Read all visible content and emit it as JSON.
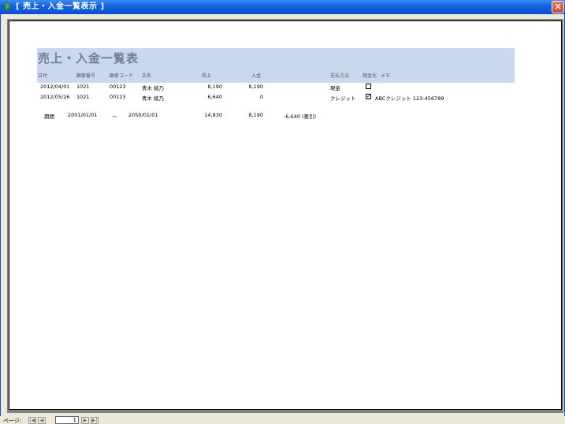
{
  "window": {
    "title": "[ 売上・入金一覧表示 ]"
  },
  "report": {
    "title": "売上・入金一覧表",
    "headers": {
      "date": "日付",
      "customer_no": "顧客番号",
      "customer_code": "顧客コード",
      "name": "氏名",
      "sales": "売上",
      "payment": "入金",
      "pay_method": "支払方法",
      "cashed": "現金化",
      "memo": "メモ"
    },
    "rows": [
      {
        "date": "2012/04/01",
        "customer_no": "1021",
        "customer_code": "00123",
        "name": "青木 綾乃",
        "sales": "8,190",
        "payment": "8,190",
        "pay_method": "現金",
        "cashed": false,
        "memo": ""
      },
      {
        "date": "2012/05/26",
        "customer_no": "1021",
        "customer_code": "00123",
        "name": "青木 綾乃",
        "sales": "6,640",
        "payment": "0",
        "pay_method": "クレジット",
        "cashed": true,
        "memo": "ABCクレジット 123-456789"
      }
    ],
    "summary": {
      "period_label": "期間",
      "start_date": "2001/01/01",
      "tilde": "～",
      "end_date": "2050/01/01",
      "total_sales": "14,830",
      "total_payment": "8,190",
      "difference": "-6,640 (差引)"
    }
  },
  "statusbar": {
    "page_label": "ページ:",
    "page_number": "1",
    "nav": {
      "first": "|◀",
      "prev": "◀",
      "next": "▶",
      "last": "▶|"
    }
  }
}
